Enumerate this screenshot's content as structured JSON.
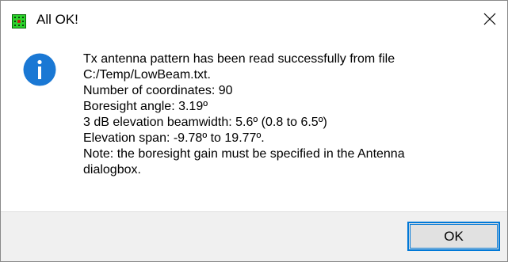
{
  "dialog": {
    "title": "All OK!",
    "icons": {
      "app": "app-grid-icon",
      "info": "info-icon",
      "close": "close-icon"
    },
    "message_lines": [
      "Tx antenna pattern has been read successfully from file",
      "C:/Temp/LowBeam.txt.",
      "Number of coordinates: 90",
      "Boresight angle: 3.19º",
      "3 dB elevation beamwidth: 5.6º (0.8 to 6.5º)",
      "Elevation span: -9.78º to 19.77º.",
      "Note: the boresight gain must be specified in the Antenna",
      "dialogbox."
    ],
    "ok_label": "OK"
  },
  "colors": {
    "info_icon": "#1a78d4",
    "focus_border": "#0078d7",
    "footer_bg": "#f0f0f0",
    "app_icon_green": "#2bd22b"
  }
}
